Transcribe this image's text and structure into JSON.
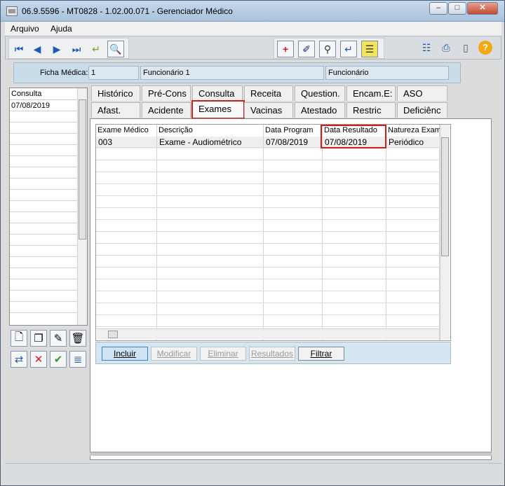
{
  "window": {
    "title": "06.9.5596 - MT0828 - 1.02.00.071 - Gerenciador Médico",
    "min": "–",
    "max": "□",
    "close": "✕"
  },
  "menu": {
    "items": [
      "Arquivo",
      "Ajuda"
    ]
  },
  "header": {
    "ficha_label": "Ficha Médica:",
    "ficha_value": "1",
    "func_name": "Funcionário 1",
    "func_type": "Funcionário"
  },
  "left_list": {
    "header": "Consulta",
    "rows": [
      "07/08/2019"
    ]
  },
  "tabs_row1": [
    "Histórico",
    "Pré-Cons",
    "Consulta",
    "Receita",
    "Question.",
    "Encam.E:",
    "ASO"
  ],
  "tabs_row2": [
    "Afast.",
    "Acidente",
    "Exames",
    "Vacinas",
    "Atestado",
    "Restric",
    "Deficiênc"
  ],
  "active_tab": "Exames",
  "grid": {
    "columns": [
      "Exame Médico",
      "Descrição",
      "Data Program",
      "Data Resultado",
      "Natureza Exame"
    ],
    "rows": [
      [
        "003",
        "Exame - Audiométrico",
        "07/08/2019",
        "07/08/2019",
        "Periódico"
      ]
    ]
  },
  "buttons": {
    "incluir": "Incluir",
    "modificar": "Modificar",
    "eliminar": "Eliminar",
    "resultados": "Resultados",
    "filtrar": "Filtrar"
  },
  "colors": {
    "accent": "#cf1c1c",
    "panel": "#c9dcea"
  }
}
